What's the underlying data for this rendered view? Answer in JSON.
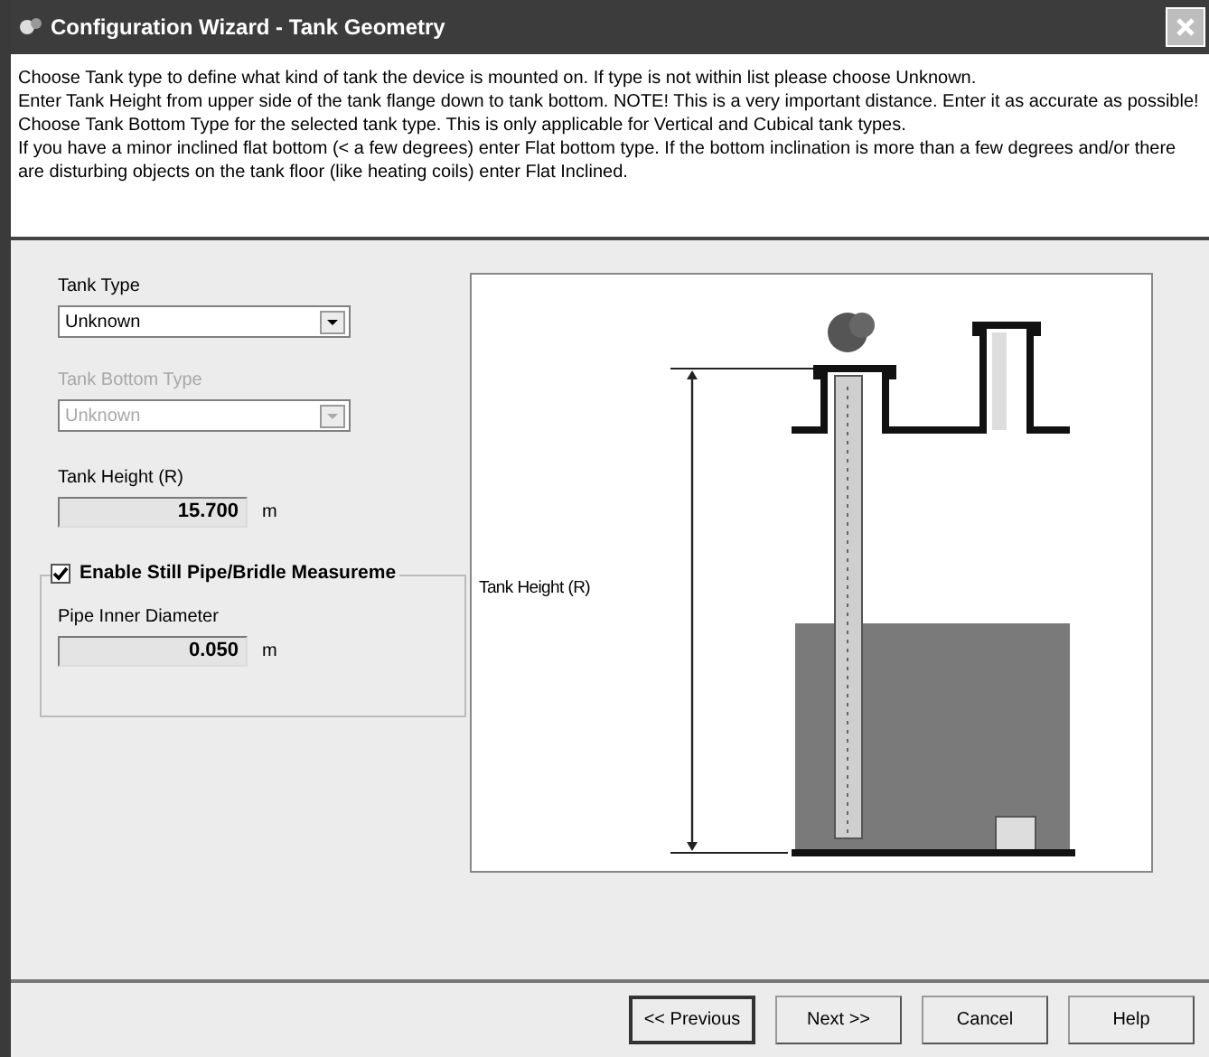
{
  "window": {
    "title": "Configuration Wizard - Tank Geometry"
  },
  "instructions": [
    "Choose Tank type to define what kind of tank the device is mounted on. If type is not within list please choose Unknown.",
    "Enter Tank Height from upper side of the tank flange down to tank bottom. NOTE! This is a very important distance. Enter it as accurate as possible!",
    "Choose Tank Bottom Type for the selected tank type. This is only applicable for Vertical and Cubical tank types.",
    "If you have a minor inclined flat bottom (< a few degrees) enter Flat bottom type. If the bottom inclination is more than a few degrees and/or there are disturbing objects on the tank floor (like heating coils) enter Flat Inclined."
  ],
  "tank_type": {
    "label": "Tank Type",
    "value": "Unknown",
    "disabled": false
  },
  "tank_bottom_type": {
    "label": "Tank Bottom Type",
    "value": "Unknown",
    "disabled": true
  },
  "tank_height": {
    "label": "Tank Height (R)",
    "value": "15.700",
    "unit": "m"
  },
  "still_pipe": {
    "label": "Enable Still Pipe/Bridle Measureme",
    "checked": true,
    "field": {
      "label": "Pipe Inner Diameter",
      "value": "0.050",
      "unit": "m"
    }
  },
  "diagram": {
    "label": "Tank Height (R)"
  },
  "buttons": [
    {
      "label": "<< Previous",
      "default": true
    },
    {
      "label": "Next >>",
      "default": false
    },
    {
      "label": "Cancel",
      "default": false
    },
    {
      "label": "Help",
      "default": false
    }
  ]
}
